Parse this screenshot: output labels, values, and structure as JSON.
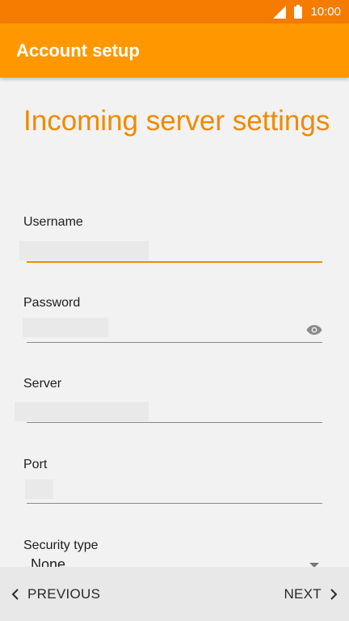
{
  "status_bar": {
    "time": "10:00",
    "signal_icon": "signal-icon",
    "battery_icon": "battery-icon",
    "color": "#f57c00"
  },
  "app_bar": {
    "title": "Account setup",
    "color": "#ff9800"
  },
  "form": {
    "heading": "Incoming server settings",
    "accent_color": "#f08a00",
    "username": {
      "label": "Username",
      "value": ""
    },
    "password": {
      "label": "Password",
      "value": "",
      "toggle_icon": "eye-icon"
    },
    "server": {
      "label": "Server",
      "value": ""
    },
    "port": {
      "label": "Port",
      "value": ""
    },
    "security_type": {
      "label": "Security type",
      "selected": "None"
    }
  },
  "bottom_nav": {
    "previous_label": "PREVIOUS",
    "next_label": "NEXT"
  }
}
